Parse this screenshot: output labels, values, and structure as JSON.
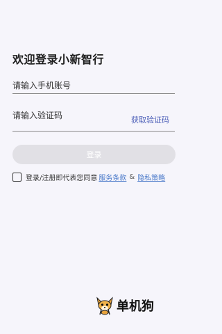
{
  "header": {
    "title": "欢迎登录小新智行"
  },
  "phone": {
    "placeholder": "请输入手机账号"
  },
  "code": {
    "placeholder": "请输入验证码",
    "get_code_label": "获取验证码"
  },
  "login": {
    "label": "登录"
  },
  "agreement": {
    "checked": false,
    "text": "登录/注册即代表您同意",
    "service_link": "服务条款",
    "amp": "&",
    "privacy_link": "隐私策略"
  },
  "watermark": {
    "text": "单机狗",
    "icon": "fox-mascot-icon"
  },
  "colors": {
    "background": "#f6f5fb",
    "link": "#4a79c9",
    "get_code": "#4c5fb8",
    "button_disabled": "#e1e0e5"
  }
}
